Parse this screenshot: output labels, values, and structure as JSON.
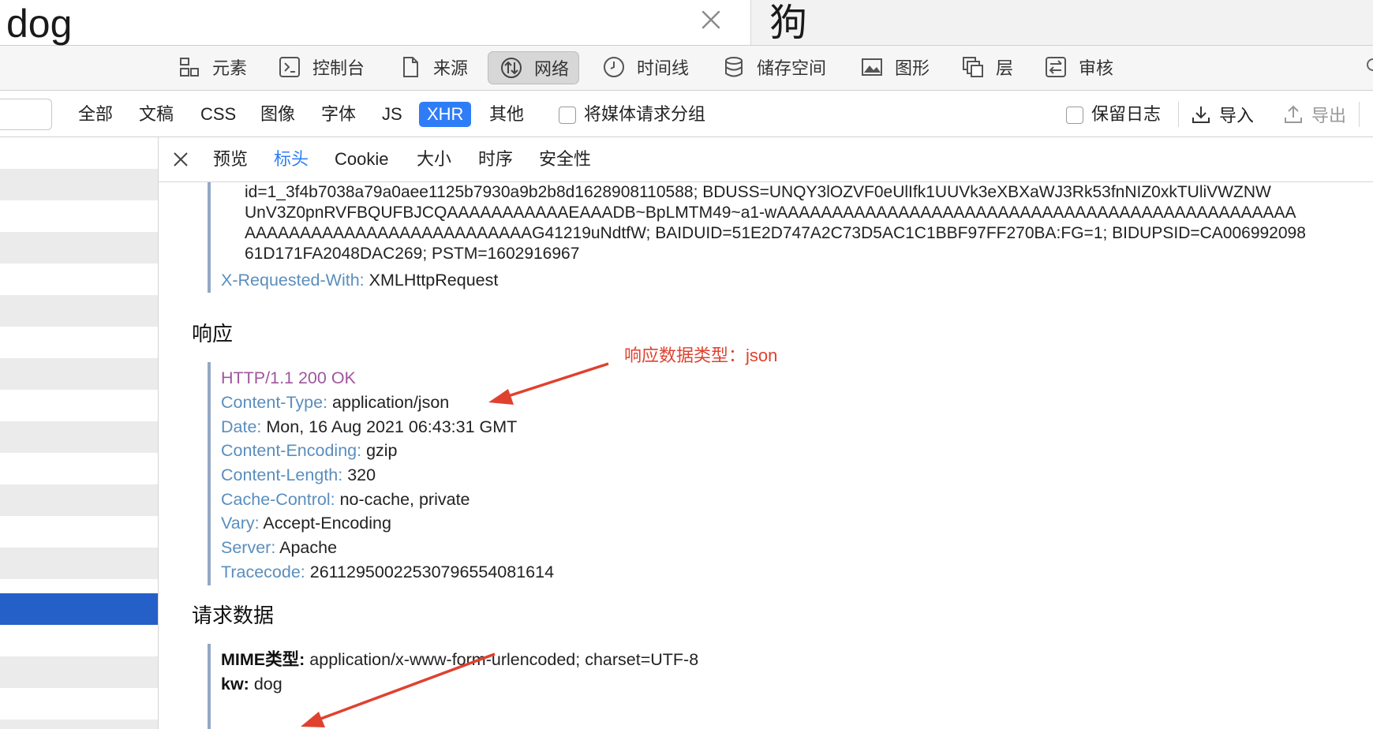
{
  "search": {
    "query": "dog",
    "translation": "狗"
  },
  "devtools_tabs": [
    {
      "label": "元素",
      "icon": "elements-icon"
    },
    {
      "label": "控制台",
      "icon": "console-icon"
    },
    {
      "label": "来源",
      "icon": "sources-icon"
    },
    {
      "label": "网络",
      "icon": "network-icon",
      "active": true
    },
    {
      "label": "时间线",
      "icon": "timeline-icon"
    },
    {
      "label": "储存空间",
      "icon": "storage-icon"
    },
    {
      "label": "图形",
      "icon": "graphics-icon"
    },
    {
      "label": "层",
      "icon": "layers-icon"
    },
    {
      "label": "审核",
      "icon": "audit-icon"
    }
  ],
  "filters": {
    "types": [
      "全部",
      "文稿",
      "CSS",
      "图像",
      "字体",
      "JS",
      "XHR",
      "其他"
    ],
    "active_type": "XHR",
    "group_media_label": "将媒体请求分组",
    "preserve_log_label": "保留日志",
    "import_label": "导入",
    "export_label": "导出"
  },
  "detail_tabs": [
    "预览",
    "标头",
    "Cookie",
    "大小",
    "时序",
    "安全性"
  ],
  "active_detail_tab": "标头",
  "request_cookie_lines": [
    "id=1_3f4b7038a79a0aee1125b7930a9b2b8d1628908110588; BDUSS=UNQY3lOZVF0eUlIfk1UUVk3eXBXaWJ3Rk53fnNIZ0xkTUliVWZNW",
    "UnV3Z0pnRVFBQUFBJCQAAAAAAAAAAAEAAADB~BpLMTM49~a1-wAAAAAAAAAAAAAAAAAAAAAAAAAAAAAAAAAAAAAAAAAAAAAAA",
    "AAAAAAAAAAAAAAAAAAAAAAAAAAG41219uNdtfW; BAIDUID=51E2D747A2C73D5AC1C1BBF97FF270BA:FG=1; BIDUPSID=CA006992098",
    "61D171FA2048DAC269; PSTM=1602916967"
  ],
  "x_requested_with": {
    "key": "X-Requested-With:",
    "value": "XMLHttpRequest"
  },
  "response": {
    "title": "响应",
    "status": "HTTP/1.1 200 OK",
    "headers": [
      {
        "key": "Content-Type:",
        "value": "application/json"
      },
      {
        "key": "Date:",
        "value": "Mon, 16 Aug 2021 06:43:31 GMT"
      },
      {
        "key": "Content-Encoding:",
        "value": "gzip"
      },
      {
        "key": "Content-Length:",
        "value": "320"
      },
      {
        "key": "Cache-Control:",
        "value": "no-cache, private"
      },
      {
        "key": "Vary:",
        "value": "Accept-Encoding"
      },
      {
        "key": "Server:",
        "value": "Apache"
      },
      {
        "key": "Tracecode:",
        "value": "26112950022530796554081614"
      }
    ]
  },
  "annotation": "响应数据类型：json",
  "request_data": {
    "title": "请求数据",
    "mime_key": "MIME类型:",
    "mime_value": "application/x-www-form-urlencoded; charset=UTF-8",
    "kw_key": "kw:",
    "kw_value": "dog"
  },
  "colors": {
    "accent": "#2f7df6",
    "selected_row": "#2560c8",
    "header_key": "#5a8ebd",
    "status_line": "#a0569e",
    "annotation": "#e0412f"
  }
}
